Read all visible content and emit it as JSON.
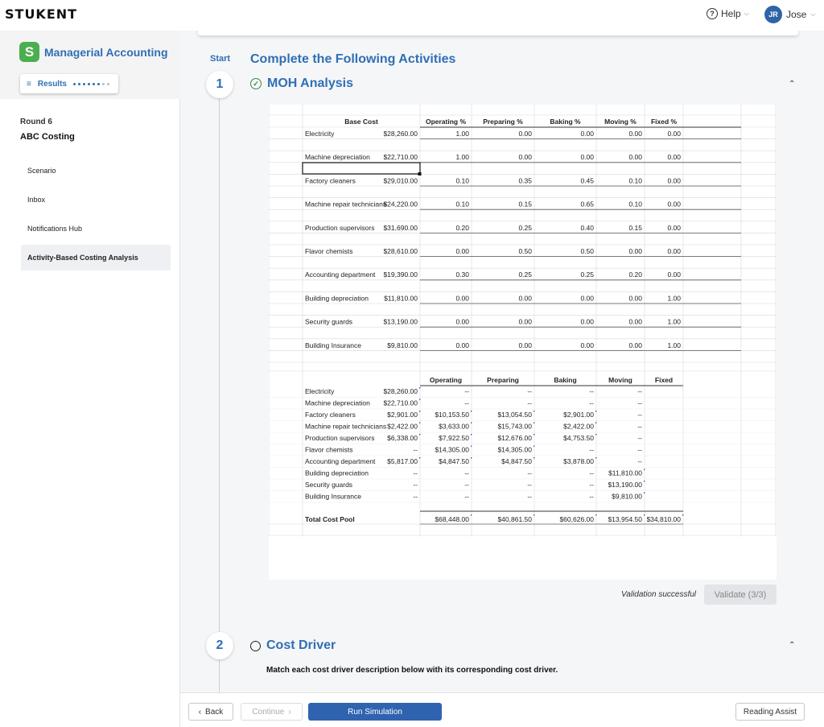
{
  "header": {
    "logo": "STUKENT",
    "help_label": "Help",
    "user_initials": "JR",
    "user_name": "Jose"
  },
  "sidebar": {
    "course_title": "Managerial Accounting",
    "results_label": "Results",
    "round_label": "Round 6",
    "round_title": "ABC Costing",
    "items": [
      {
        "label": "Scenario",
        "active": false
      },
      {
        "label": "Inbox",
        "active": false
      },
      {
        "label": "Notifications Hub",
        "active": false
      },
      {
        "label": "Activity-Based Costing Analysis",
        "active": true
      }
    ]
  },
  "main": {
    "start_label": "Start",
    "section_title": "Complete the Following Activities",
    "steps": [
      {
        "number": "1",
        "title": "MOH Analysis",
        "status": "complete"
      },
      {
        "number": "2",
        "title": "Cost Driver",
        "status": "incomplete"
      }
    ],
    "validation_message": "Validation successful",
    "validate_label": "Validate (3/3)",
    "instruction": "Match each cost driver description below with its corresponding cost driver."
  },
  "table1": {
    "headers": [
      "Base Cost",
      "Operating %",
      "Preparing %",
      "Baking %",
      "Moving %",
      "Fixed %"
    ],
    "rows": [
      [
        "Electricity",
        "$28,260.00",
        "1.00",
        "0.00",
        "0.00",
        "0.00",
        "0.00"
      ],
      [
        "Machine depreciation",
        "$22,710.00",
        "1.00",
        "0.00",
        "0.00",
        "0.00",
        "0.00"
      ],
      [
        "Factory cleaners",
        "$29,010.00",
        "0.10",
        "0.35",
        "0.45",
        "0.10",
        "0.00"
      ],
      [
        "Machine repair technicians",
        "$24,220.00",
        "0.10",
        "0.15",
        "0.65",
        "0.10",
        "0.00"
      ],
      [
        "Production supervisors",
        "$31,690.00",
        "0.20",
        "0.25",
        "0.40",
        "0.15",
        "0.00"
      ],
      [
        "Flavor chemists",
        "$28,610.00",
        "0.00",
        "0.50",
        "0.50",
        "0.00",
        "0.00"
      ],
      [
        "Accounting department",
        "$19,390.00",
        "0.30",
        "0.25",
        "0.25",
        "0.20",
        "0.00"
      ],
      [
        "Building depreciation",
        "$11,810.00",
        "0.00",
        "0.00",
        "0.00",
        "0.00",
        "1.00"
      ],
      [
        "Security guards",
        "$13,190.00",
        "0.00",
        "0.00",
        "0.00",
        "0.00",
        "1.00"
      ],
      [
        "Building Insurance",
        "$9,810.00",
        "0.00",
        "0.00",
        "0.00",
        "0.00",
        "1.00"
      ]
    ]
  },
  "table2": {
    "headers": [
      "Operating",
      "Preparing",
      "Baking",
      "Moving",
      "Fixed"
    ],
    "rows": [
      [
        "Electricity",
        "$28,260.00",
        "--",
        "--",
        "--",
        "--"
      ],
      [
        "Machine depreciation",
        "$22,710.00",
        "--",
        "--",
        "--",
        "--"
      ],
      [
        "Factory cleaners",
        "$2,901.00",
        "$10,153.50",
        "$13,054.50",
        "$2,901.00",
        "--"
      ],
      [
        "Machine repair technicians",
        "$2,422.00",
        "$3,633.00",
        "$15,743.00",
        "$2,422.00",
        "--"
      ],
      [
        "Production supervisors",
        "$6,338.00",
        "$7,922.50",
        "$12,676.00",
        "$4,753.50",
        "--"
      ],
      [
        "Flavor chemists",
        "--",
        "$14,305.00",
        "$14,305.00",
        "--",
        "--"
      ],
      [
        "Accounting department",
        "$5,817.00",
        "$4,847.50",
        "$4,847.50",
        "$3,878.00",
        "--"
      ],
      [
        "Building depreciation",
        "--",
        "--",
        "--",
        "--",
        "$11,810.00"
      ],
      [
        "Security guards",
        "--",
        "--",
        "--",
        "--",
        "$13,190.00"
      ],
      [
        "Building Insurance",
        "--",
        "--",
        "--",
        "--",
        "$9,810.00"
      ]
    ],
    "total_label": "Total Cost Pool",
    "totals": [
      "$68,448.00",
      "$40,861.50",
      "$60,626.00",
      "$13,954.50",
      "$34,810.00"
    ]
  },
  "footer": {
    "back_label": "Back",
    "continue_label": "Continue",
    "run_label": "Run Simulation",
    "reading_label": "Reading Assist"
  }
}
